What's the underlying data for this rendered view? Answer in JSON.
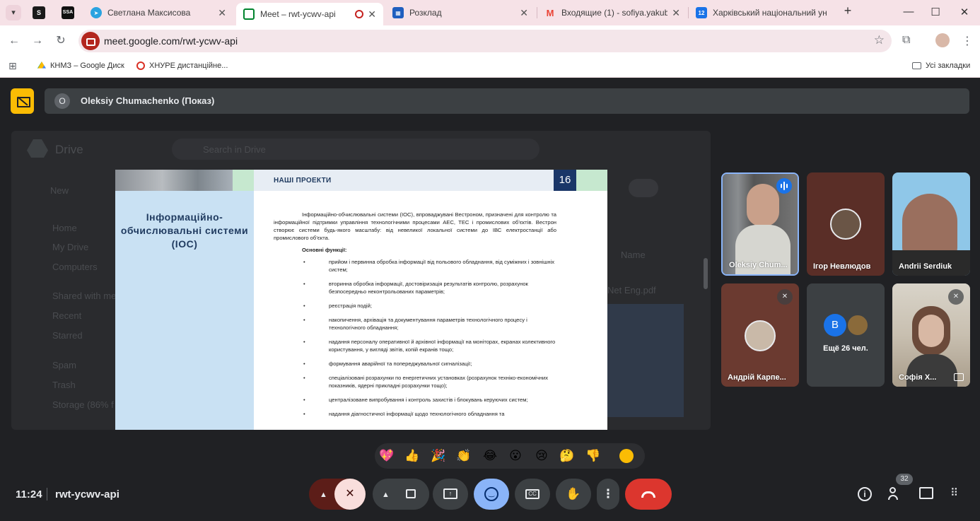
{
  "browser": {
    "pinned": [
      {
        "name": "pinned-tab-s",
        "letter": "S",
        "color": "#1a1a1a"
      },
      {
        "name": "pinned-tab-ssa",
        "letter": "SSA",
        "color": "#111111"
      }
    ],
    "tabs": [
      {
        "title": "Светлана Максисова",
        "icon": "telegram-icon",
        "color": "#2aa3e0",
        "active": false
      },
      {
        "title": "Meet – rwt-ycwv-api",
        "icon": "meet-icon",
        "color": "#00832d",
        "active": true
      },
      {
        "title": "Розклад",
        "icon": "schedule-icon",
        "color": "#1f5fbf",
        "active": false
      },
      {
        "title": "Входящие (1) - sofiya.yakubov",
        "icon": "gmail-icon",
        "color": "#ea4335",
        "active": false
      },
      {
        "title": "Харківський національний ун",
        "icon": "calendar-icon",
        "color": "#1a73e8",
        "active": false
      }
    ],
    "url": "meet.google.com/rwt-ycwv-api",
    "bookmarks": [
      {
        "label": "КНМЗ – Google Диск",
        "icon": "google-drive-icon"
      },
      {
        "label": "ХНУРЕ дистанційне...",
        "icon": "nure-icon"
      }
    ],
    "all_bookmarks": "Усі закладки"
  },
  "meet": {
    "presenter_badge": "O",
    "presenter_label": "Oleksiy Chumachenko (Показ)",
    "slide": {
      "header": "НАШІ ПРОЕКТИ",
      "number": "16",
      "title": "Інформаційно-обчислювальні системи (ІОС)",
      "intro": "Інформаційно-обчислювальні системи (ІОС), впроваджувані Вестроном, призначені для контролю та інформаційної підтримки управління технологічними процесами АЕС, ТЕС і промислових об’єктів. Вестрон створює системи будь-якого масштабу: від невеликої локальної системи до ІВС електростанції або промислового об’єкта.",
      "functions_label": "Основні функції:",
      "items": [
        "прийом і первинна обробка інформації від польового обладнання, від суміжних і зовнішніх систем;",
        "вторинна обробка інформації, достовіризація результатів контролю, розрахунок безпосередньо неконтрольованих параметрів;",
        "реєстрація подій;",
        "накопичення, архівація та документування параметрів технологічного процесу і технологічного обладнання;",
        "надання персоналу оперативної й архівної інформації на моніторах, екранах колективного користування, у вигляді звітів, копій екранів тощо;",
        "формування аварійної та попереджувальної сигналізації;",
        "спеціалізовані розрахунки по енергетичних установках (розрахунок техніко-економічних показників, ядерні прикладні розрахунки тощо);",
        "централізоване випробування і контроль захистів і блокувань керуючих систем;",
        "надання діагностичної інформації щодо технологічного обладнання та"
      ]
    },
    "drive_bg": {
      "title": "Drive",
      "search": "Search in Drive",
      "new": "New",
      "nav": [
        "Home",
        "My Drive",
        "Computers",
        "Shared with me",
        "Recent",
        "Starred",
        "Spam",
        "Trash",
        "Storage (86% f"
      ],
      "name_col": "Name",
      "file": "Net Eng.pdf"
    },
    "participants": [
      {
        "name": "Oleksiy Chum...",
        "speaking": true
      },
      {
        "name": "Ігор Невлюдов",
        "speaking": false
      },
      {
        "name": "Andrii Serdiuk",
        "speaking": false
      },
      {
        "name": "Андрій Карпе...",
        "muted": true
      },
      {
        "name": "Ещё 26 чел.",
        "avatar_letter": "B"
      },
      {
        "name": "Софія Х...",
        "muted": true
      }
    ],
    "reactions": [
      "💖",
      "👍",
      "🎉",
      "👏",
      "😂",
      "😮",
      "😢",
      "🤔",
      "👎"
    ],
    "time": "11:24",
    "meeting_code": "rwt-ycwv-api",
    "people_count": "32"
  }
}
